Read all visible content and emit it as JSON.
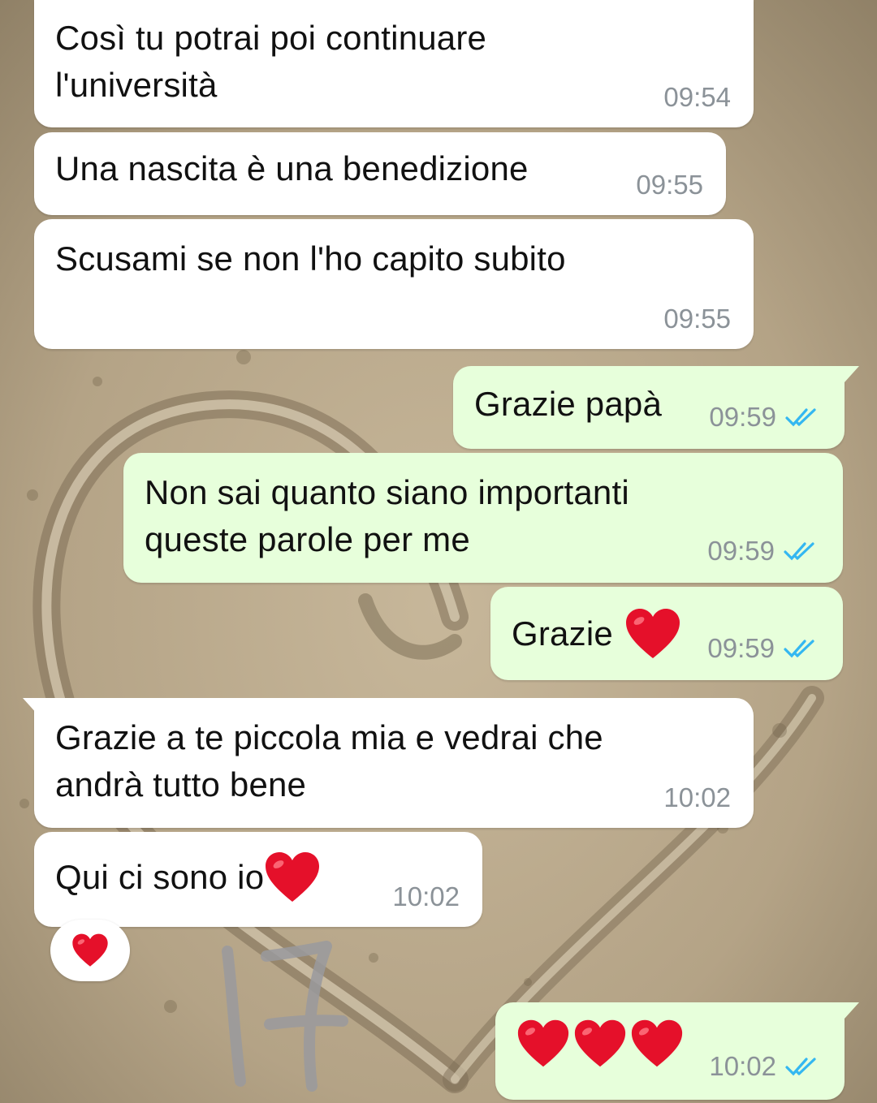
{
  "wallpaper": "beach-sand-heart",
  "colors": {
    "incoming_bubble": "#ffffff",
    "outgoing_bubble": "#e7ffdb",
    "timestamp": "#8b9298",
    "read_ticks": "#34b7f1",
    "heart": "#e5102a"
  },
  "messages": [
    {
      "direction": "in",
      "text": "Così tu potrai poi continuare\nl'università",
      "time": "09:54"
    },
    {
      "direction": "in",
      "text": "Una nascita è una benedizione",
      "time": "09:55"
    },
    {
      "direction": "in",
      "text": "Scusami se non l'ho capito subito",
      "time": "09:55"
    },
    {
      "direction": "out",
      "text": "Grazie papà",
      "time": "09:59",
      "status": "read"
    },
    {
      "direction": "out",
      "text": "Non sai quanto siano importanti\nqueste parole per me",
      "time": "09:59",
      "status": "read"
    },
    {
      "direction": "out",
      "text": "Grazie",
      "emoji": "heart",
      "time": "09:59",
      "status": "read"
    },
    {
      "direction": "in",
      "text": "Grazie a te piccola mia e vedrai che\nandrà tutto bene",
      "time": "10:02"
    },
    {
      "direction": "in",
      "text": "Qui ci sono io",
      "emoji": "heart",
      "time": "10:02",
      "reaction": "heart"
    },
    {
      "direction": "out",
      "emoji_count": 3,
      "emoji": "heart",
      "time": "10:02",
      "status": "read"
    }
  ],
  "overlay_annotation": "17"
}
